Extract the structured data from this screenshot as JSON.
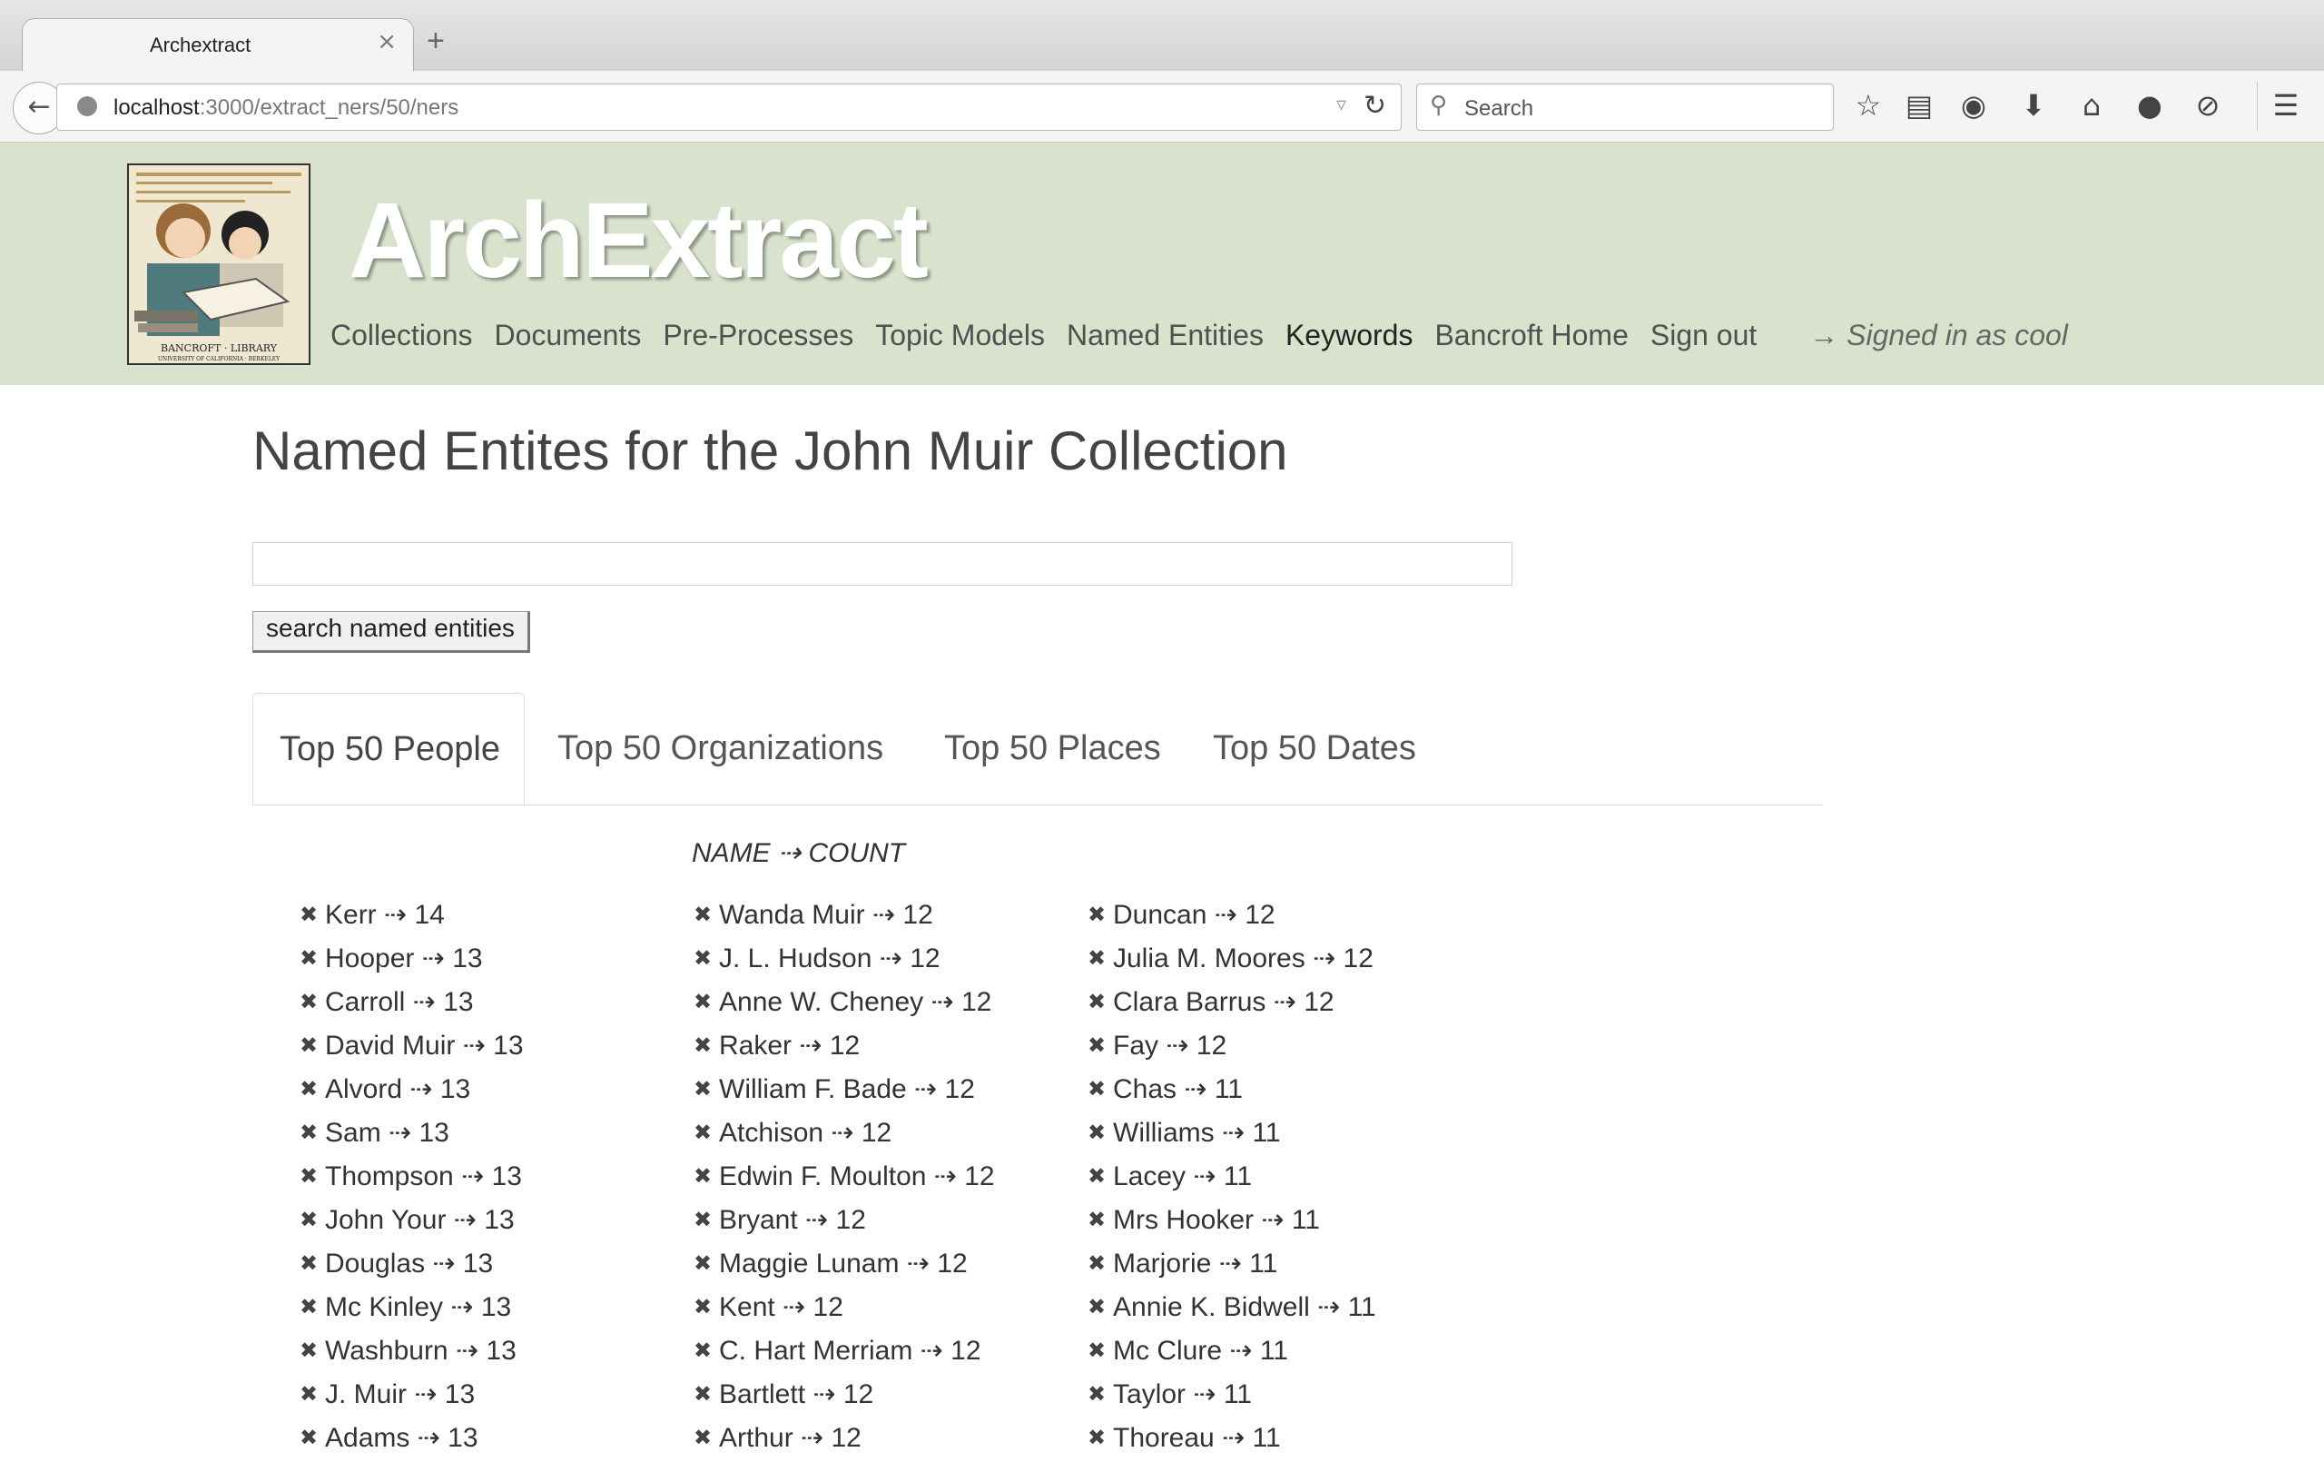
{
  "browser": {
    "tab_title": "Archextract",
    "new_tab": "+",
    "close_glyph": "×",
    "url_host": "localhost",
    "url_path": ":3000/extract_ners/50/ners",
    "search_placeholder": "Search",
    "icons": [
      "back-icon",
      "globe-icon",
      "reload-icon",
      "search-icon",
      "bookmark-star-icon",
      "reading-list-icon",
      "pocket-icon",
      "download-icon",
      "home-icon",
      "chat-icon",
      "tracking-icon",
      "menu-icon"
    ]
  },
  "site": {
    "brand": "ArchExtract",
    "nav": [
      {
        "label": "Collections"
      },
      {
        "label": "Documents"
      },
      {
        "label": "Pre-Processes"
      },
      {
        "label": "Topic Models"
      },
      {
        "label": "Named Entities"
      },
      {
        "label": "Keywords"
      },
      {
        "label": "Bancroft Home"
      },
      {
        "label": "Sign out"
      }
    ],
    "signed_in": "→ Signed in as cool"
  },
  "page": {
    "title": "Named Entites for the John Muir Collection",
    "search_value": "",
    "search_button": "search named entities",
    "tabs": [
      {
        "label": "Top 50 People",
        "active": true
      },
      {
        "label": "Top 50 Organizations",
        "active": false
      },
      {
        "label": "Top 50 Places",
        "active": false
      },
      {
        "label": "Top 50 Dates",
        "active": false
      }
    ],
    "column_header": "NAME ⇢ COUNT",
    "remove_glyph": "✖",
    "columns": [
      [
        "Kerr ⇢ 14",
        "Hooper ⇢ 13",
        "Carroll ⇢ 13",
        "David Muir ⇢ 13",
        "Alvord ⇢ 13",
        "Sam ⇢ 13",
        "Thompson ⇢ 13",
        "John Your ⇢ 13",
        "Douglas ⇢ 13",
        "Mc Kinley ⇢ 13",
        "Washburn ⇢ 13",
        "J. Muir ⇢ 13",
        "Adams ⇢ 13"
      ],
      [
        "Wanda Muir ⇢ 12",
        "J. L. Hudson ⇢ 12",
        "Anne W. Cheney ⇢ 12",
        "Raker ⇢ 12",
        "William F. Bade ⇢ 12",
        "Atchison ⇢ 12",
        "Edwin F. Moulton ⇢ 12",
        "Bryant ⇢ 12",
        "Maggie Lunam ⇢ 12",
        "Kent ⇢ 12",
        "C. Hart Merriam ⇢ 12",
        "Bartlett ⇢ 12",
        "Arthur ⇢ 12"
      ],
      [
        "Duncan ⇢ 12",
        "Julia M. Moores ⇢ 12",
        "Clara Barrus ⇢ 12",
        "Fay ⇢ 12",
        "Chas ⇢ 11",
        "Williams ⇢ 11",
        "Lacey ⇢ 11",
        "Mrs Hooker ⇢ 11",
        "Marjorie ⇢ 11",
        "Annie K. Bidwell ⇢ 11",
        "Mc Clure ⇢ 11",
        "Taylor ⇢ 11",
        "Thoreau ⇢ 11"
      ]
    ]
  }
}
